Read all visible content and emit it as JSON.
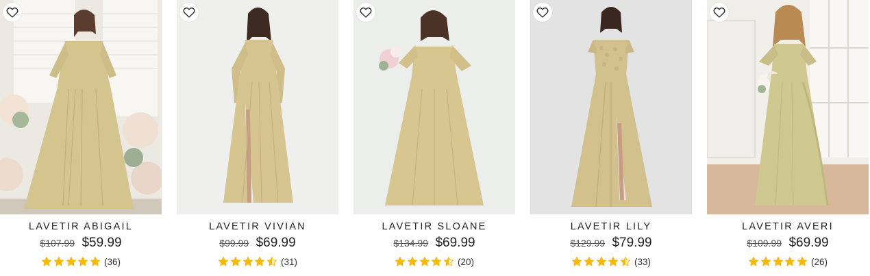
{
  "products": [
    {
      "name": "LAVETIR ABIGAIL",
      "old_price": "$107.99",
      "price": "$59.99",
      "review_count": "(36)",
      "rating": 5,
      "icon_wishlist": "heart-outline-icon",
      "photo_scene": "white studio with shutters and flower arrangements",
      "colors": {
        "dress": "#d4c58f",
        "background": "#ece9e3"
      }
    },
    {
      "name": "LAVETIR VIVIAN",
      "old_price": "$99.99",
      "price": "$69.99",
      "review_count": "(31)",
      "rating": 4.5,
      "icon_wishlist": "heart-outline-icon",
      "photo_scene": "plain light grey backdrop",
      "colors": {
        "dress": "#d6c591",
        "background": "#efefed"
      }
    },
    {
      "name": "LAVETIR SLOANE",
      "old_price": "$134.99",
      "price": "$69.99",
      "review_count": "(20)",
      "rating": 4.5,
      "icon_wishlist": "heart-outline-icon",
      "photo_scene": "plain light grey backdrop, model holding a bouquet",
      "colors": {
        "dress": "#d8c690",
        "background": "#eceeec"
      }
    },
    {
      "name": "LAVETIR LILY",
      "old_price": "$129.99",
      "price": "$79.99",
      "review_count": "(33)",
      "rating": 4.5,
      "icon_wishlist": "heart-outline-icon",
      "photo_scene": "plain grey backdrop",
      "colors": {
        "dress": "#d2c18c",
        "background": "#e3e3e3"
      }
    },
    {
      "name": "LAVETIR AVERI",
      "old_price": "$109.99",
      "price": "$69.99",
      "review_count": "(26)",
      "rating": 5,
      "icon_wishlist": "heart-outline-icon",
      "photo_scene": "bright room with window and wood floor, model holding a bouquet",
      "colors": {
        "dress": "#d0c891",
        "background": "#f1efea"
      }
    }
  ],
  "colors": {
    "star": "#f5b90d",
    "text": "#222222",
    "muted": "#555555"
  }
}
